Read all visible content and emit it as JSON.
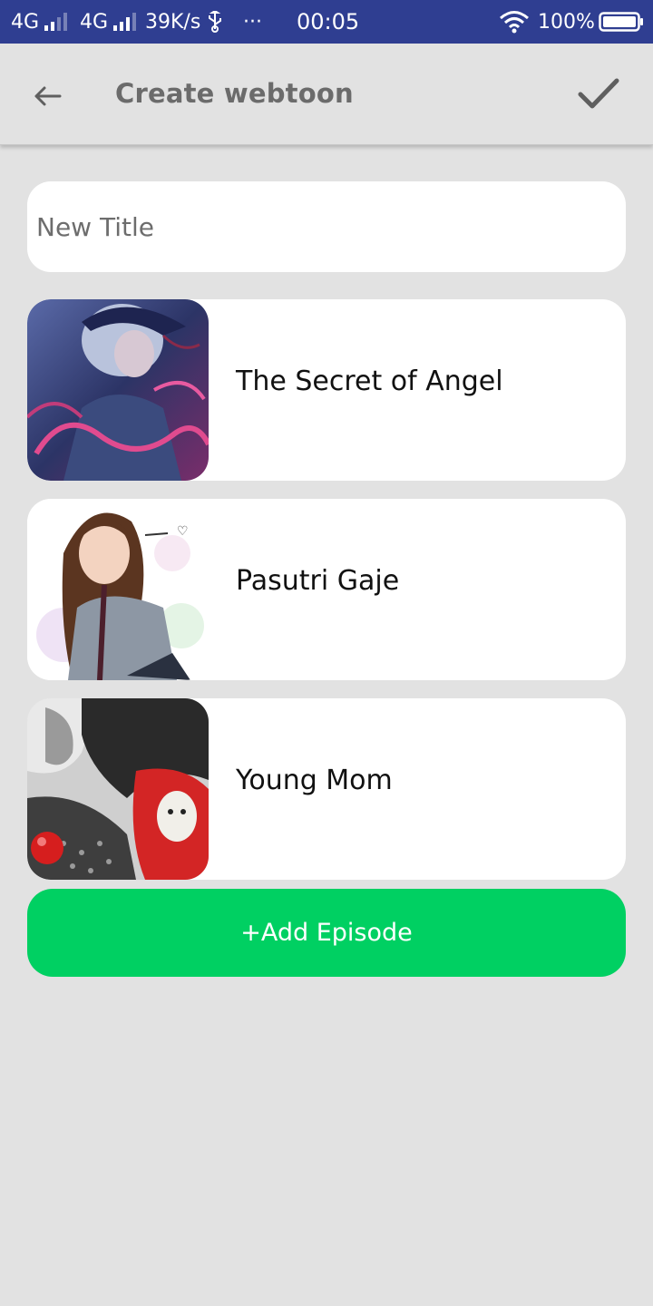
{
  "status_bar": {
    "net1": "4G",
    "net2": "4G",
    "speed": "39K/s",
    "usb_icon": "usb-icon",
    "dots": "···",
    "time": "00:05",
    "wifi_icon": "wifi-icon",
    "battery_text": "100%",
    "battery_icon": "battery-icon",
    "bg_color": "#2f3e91"
  },
  "app_bar": {
    "back_icon": "arrow-left-icon",
    "title": "Create webtoon",
    "confirm_icon": "check-icon"
  },
  "title_input": {
    "placeholder": "New Title",
    "value": ""
  },
  "episodes": [
    {
      "title": "The Secret of Angel",
      "thumb_icon": "cover-image"
    },
    {
      "title": "Pasutri Gaje",
      "thumb_icon": "cover-image"
    },
    {
      "title": "Young Mom",
      "thumb_icon": "cover-image"
    }
  ],
  "add_button": {
    "label": "+Add Episode",
    "color": "#00d062"
  },
  "colors": {
    "background": "#e2e2e2",
    "card": "#ffffff",
    "accent": "#00d062"
  }
}
